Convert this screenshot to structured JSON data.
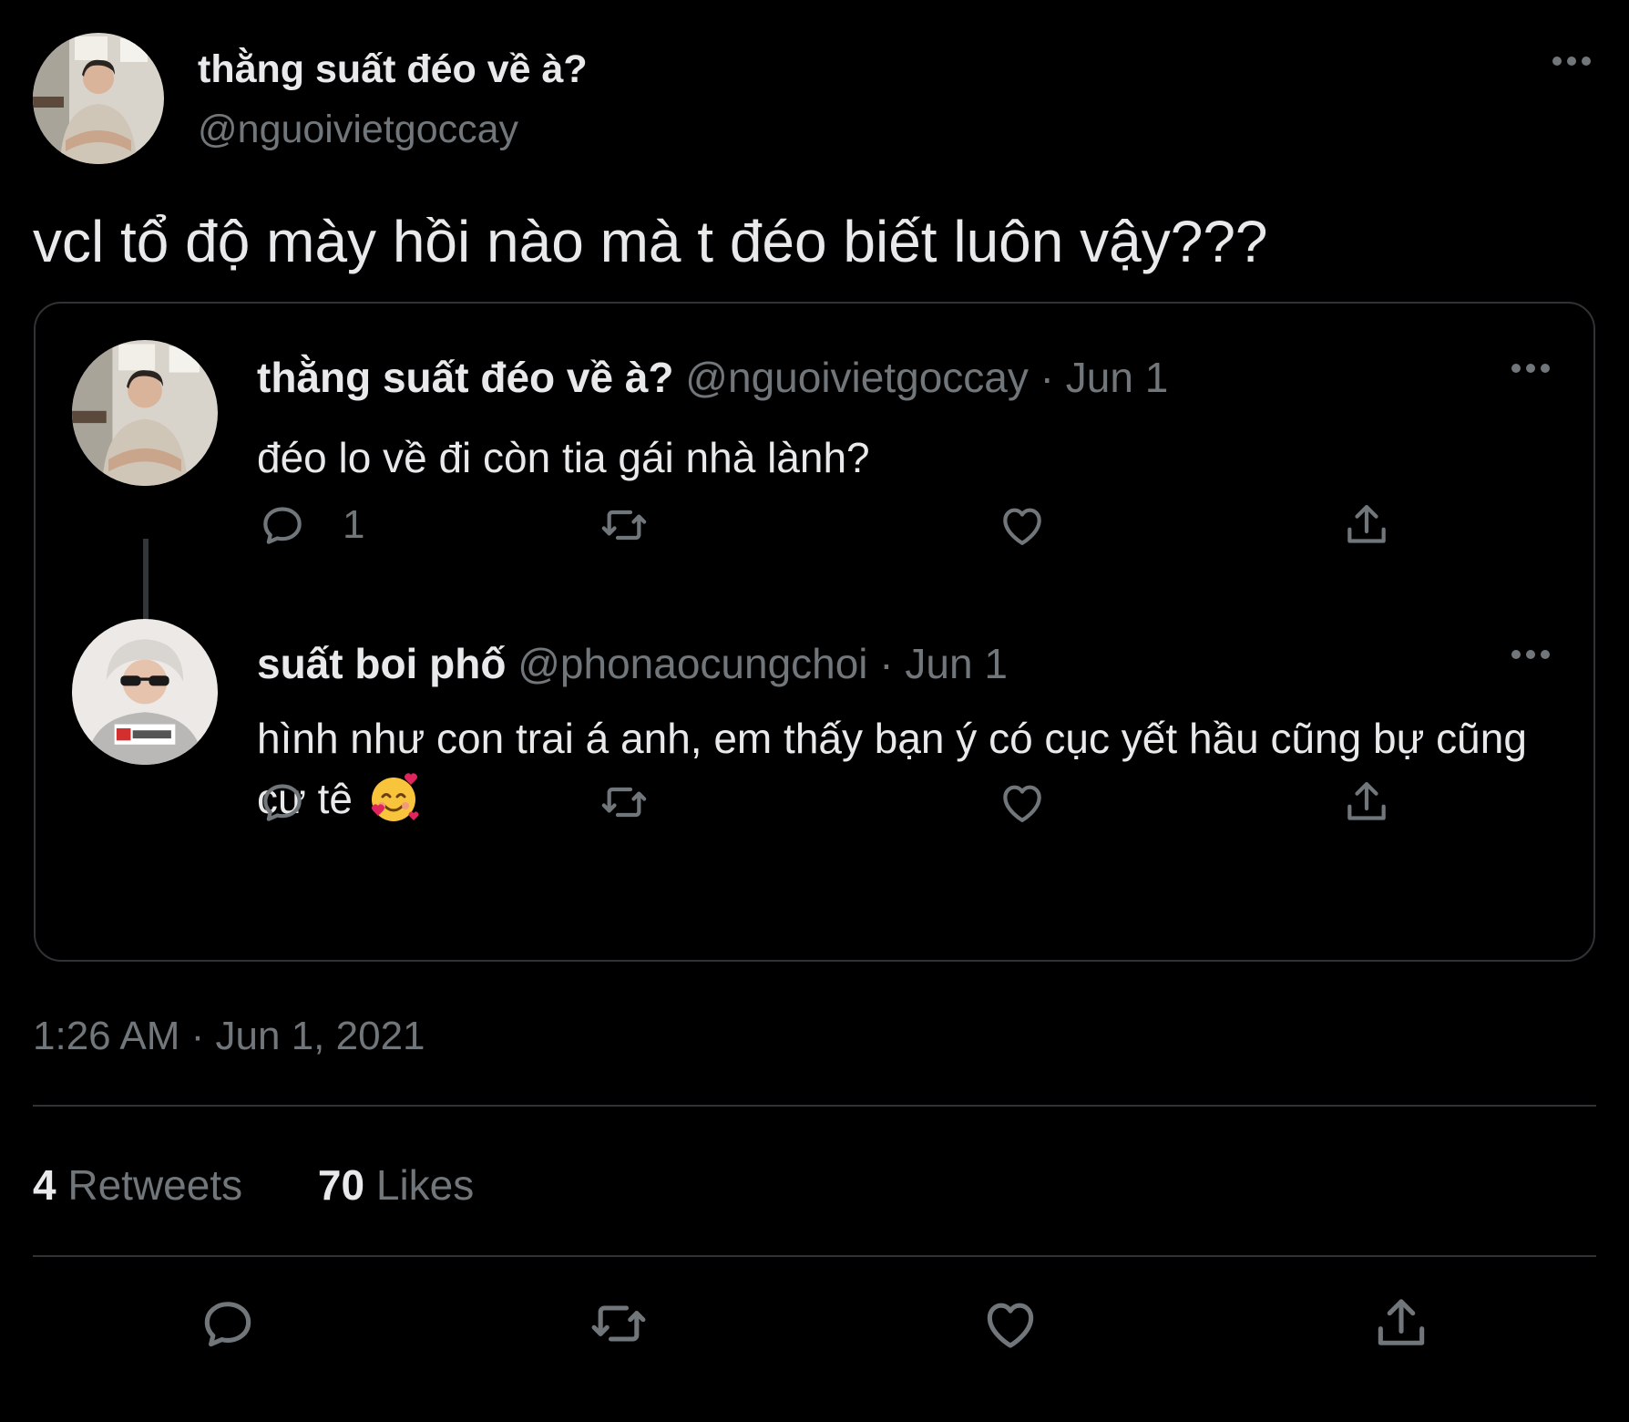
{
  "header": {
    "display_name": "thằng suất đéo về à?",
    "handle": "@nguoivietgoccay"
  },
  "tweet": {
    "text": "vcl tổ độ mày hồi nào mà t đéo biết luôn vậy???",
    "timestamp": "1:26 AM · Jun 1, 2021"
  },
  "thread": [
    {
      "display_name": "thằng suất đéo về à?",
      "handle_date": " @nguoivietgoccay · Jun 1",
      "text": "đéo lo về đi còn tia gái nhà lành?",
      "reply_count": "1"
    },
    {
      "display_name": "suất boi phố",
      "handle_date": " @phonaocungchoi · Jun 1",
      "text": "hình như con trai á anh, em thấy bạn ý có cục yết hầu cũng bự cũng cư tê ",
      "emoji": "smiling-face-with-hearts"
    }
  ],
  "stats": {
    "retweets_count": "4",
    "retweets_label": " Retweets",
    "likes_count": "70",
    "likes_label": " Likes"
  },
  "icons": {
    "more": "more-horizontal-icon",
    "reply": "reply-icon",
    "retweet": "retweet-icon",
    "like": "heart-icon",
    "share": "share-icon"
  },
  "colors": {
    "background": "#000000",
    "primary_text": "#e7e9ea",
    "secondary_text": "#71767b",
    "border": "#2f3336"
  }
}
